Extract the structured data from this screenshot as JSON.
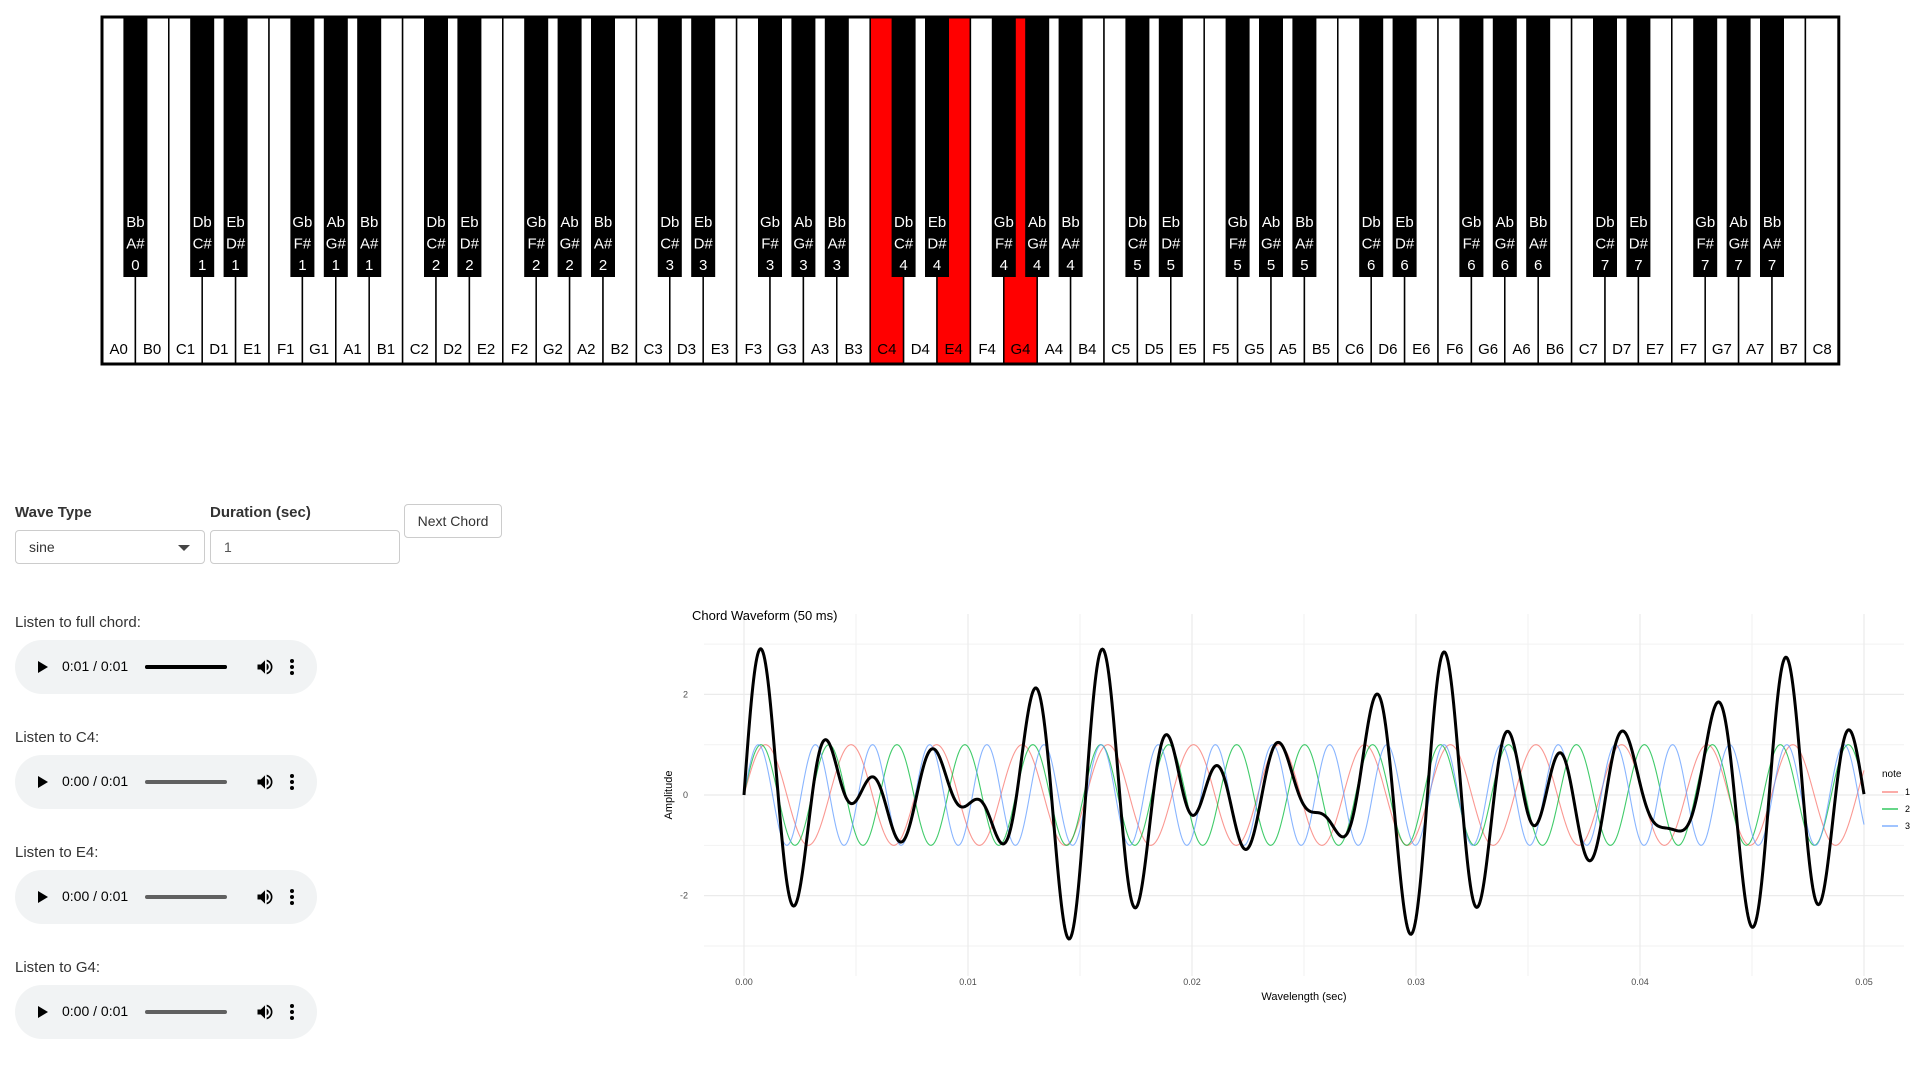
{
  "piano": {
    "white_keys": [
      "A0",
      "B0",
      "C1",
      "D1",
      "E1",
      "F1",
      "G1",
      "A1",
      "B1",
      "C2",
      "D2",
      "E2",
      "F2",
      "G2",
      "A2",
      "B2",
      "C3",
      "D3",
      "E3",
      "F3",
      "G3",
      "A3",
      "B3",
      "C4",
      "D4",
      "E4",
      "F4",
      "G4",
      "A4",
      "B4",
      "C5",
      "D5",
      "E5",
      "F5",
      "G5",
      "A5",
      "B5",
      "C6",
      "D6",
      "E6",
      "F6",
      "G6",
      "A6",
      "B6",
      "C7",
      "D7",
      "E7",
      "F7",
      "G7",
      "A7",
      "B7",
      "C8"
    ],
    "black_keys": [
      {
        "flat": "Bb",
        "sharp": "A#",
        "octave": "0"
      },
      {
        "flat": "Db",
        "sharp": "C#",
        "octave": "1"
      },
      {
        "flat": "Eb",
        "sharp": "D#",
        "octave": "1"
      },
      {
        "flat": "Gb",
        "sharp": "F#",
        "octave": "1"
      },
      {
        "flat": "Ab",
        "sharp": "G#",
        "octave": "1"
      },
      {
        "flat": "Bb",
        "sharp": "A#",
        "octave": "1"
      },
      {
        "flat": "Db",
        "sharp": "C#",
        "octave": "2"
      },
      {
        "flat": "Eb",
        "sharp": "D#",
        "octave": "2"
      },
      {
        "flat": "Gb",
        "sharp": "F#",
        "octave": "2"
      },
      {
        "flat": "Ab",
        "sharp": "G#",
        "octave": "2"
      },
      {
        "flat": "Bb",
        "sharp": "A#",
        "octave": "2"
      },
      {
        "flat": "Db",
        "sharp": "C#",
        "octave": "3"
      },
      {
        "flat": "Eb",
        "sharp": "D#",
        "octave": "3"
      },
      {
        "flat": "Gb",
        "sharp": "F#",
        "octave": "3"
      },
      {
        "flat": "Ab",
        "sharp": "G#",
        "octave": "3"
      },
      {
        "flat": "Bb",
        "sharp": "A#",
        "octave": "3"
      },
      {
        "flat": "Db",
        "sharp": "C#",
        "octave": "4"
      },
      {
        "flat": "Eb",
        "sharp": "D#",
        "octave": "4"
      },
      {
        "flat": "Gb",
        "sharp": "F#",
        "octave": "4"
      },
      {
        "flat": "Ab",
        "sharp": "G#",
        "octave": "4"
      },
      {
        "flat": "Bb",
        "sharp": "A#",
        "octave": "4"
      },
      {
        "flat": "Db",
        "sharp": "C#",
        "octave": "5"
      },
      {
        "flat": "Eb",
        "sharp": "D#",
        "octave": "5"
      },
      {
        "flat": "Gb",
        "sharp": "F#",
        "octave": "5"
      },
      {
        "flat": "Ab",
        "sharp": "G#",
        "octave": "5"
      },
      {
        "flat": "Bb",
        "sharp": "A#",
        "octave": "5"
      },
      {
        "flat": "Db",
        "sharp": "C#",
        "octave": "6"
      },
      {
        "flat": "Eb",
        "sharp": "D#",
        "octave": "6"
      },
      {
        "flat": "Gb",
        "sharp": "F#",
        "octave": "6"
      },
      {
        "flat": "Ab",
        "sharp": "G#",
        "octave": "6"
      },
      {
        "flat": "Bb",
        "sharp": "A#",
        "octave": "6"
      },
      {
        "flat": "Db",
        "sharp": "C#",
        "octave": "7"
      },
      {
        "flat": "Eb",
        "sharp": "D#",
        "octave": "7"
      },
      {
        "flat": "Gb",
        "sharp": "F#",
        "octave": "7"
      },
      {
        "flat": "Ab",
        "sharp": "G#",
        "octave": "7"
      },
      {
        "flat": "Bb",
        "sharp": "A#",
        "octave": "7"
      }
    ],
    "highlighted": [
      "C4",
      "E4",
      "G4"
    ],
    "highlight_color": "#ff0000"
  },
  "controls": {
    "wave_type_label": "Wave Type",
    "wave_type_value": "sine",
    "duration_label": "Duration (sec)",
    "duration_value": "1",
    "next_chord_label": "Next Chord"
  },
  "players": [
    {
      "label": "Listen to full chord:",
      "time": "0:01 / 0:01",
      "progress": 1.0
    },
    {
      "label": "Listen to C4:",
      "time": "0:00 / 0:01",
      "progress": 0.0
    },
    {
      "label": "Listen to E4:",
      "time": "0:00 / 0:01",
      "progress": 0.0
    },
    {
      "label": "Listen to G4:",
      "time": "0:00 / 0:01",
      "progress": 0.0
    }
  ],
  "chart_data": {
    "type": "line",
    "title": "Chord Waveform (50 ms)",
    "xlabel": "Wavelength (sec)",
    "ylabel": "Amplitude",
    "xlim": [
      0,
      0.05
    ],
    "ylim": [
      -3.2,
      3.2
    ],
    "x_ticks": [
      "0.00",
      "0.01",
      "0.02",
      "0.03",
      "0.04",
      "0.05"
    ],
    "y_ticks": [
      "-2",
      "0",
      "2"
    ],
    "grid": true,
    "legend_title": "note",
    "legend_position": "right",
    "series": [
      {
        "name": "1",
        "frequency_hz": 261.63,
        "color": "#F8766D"
      },
      {
        "name": "2",
        "frequency_hz": 329.63,
        "color": "#00BA38"
      },
      {
        "name": "3",
        "frequency_hz": 392.0,
        "color": "#619CFF"
      }
    ],
    "sum_series": {
      "color": "#000000"
    }
  }
}
